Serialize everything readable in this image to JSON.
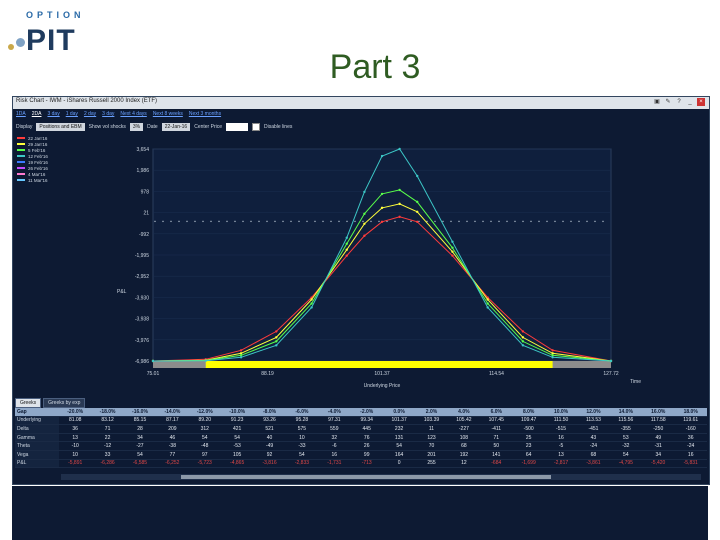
{
  "logo": {
    "top": "OPTION",
    "main": "PIT"
  },
  "slide_title": "Part 3",
  "window": {
    "title": "Risk Chart - IWM - iShares Russell 2000 Index (ETF)"
  },
  "ranges": [
    "1DA",
    "2DA",
    "3 day",
    "1 day",
    "2 day",
    "3 day",
    "Next 4 days",
    "Next 8 weeks",
    "Next 3 months"
  ],
  "toolbar": {
    "display_label": "Display",
    "display_value": "Positions and EBM",
    "vol_label": "Show vol shocks",
    "vol_value": "3%",
    "date_label": "Date",
    "date_value": "22-Jan-16",
    "center_label": "Center Price",
    "disable_label": "Disable lines"
  },
  "legend": [
    {
      "label": "22 Jan'16",
      "color": "#ff3b3b"
    },
    {
      "label": "29 Jan'16",
      "color": "#ffff3b"
    },
    {
      "label": "5 Feb'16",
      "color": "#59ff4a"
    },
    {
      "label": "12 Feb'16",
      "color": "#3cc7c7"
    },
    {
      "label": "19 Feb'16",
      "color": "#3b7bff"
    },
    {
      "label": "26 Feb'16",
      "color": "#c44bff"
    },
    {
      "label": "4 Mar'16",
      "color": "#ff7ad1"
    },
    {
      "label": "11 Mar'16",
      "color": "#66c8ff"
    }
  ],
  "axes": {
    "ylabel": "P&L",
    "xlabel": "Underlying Price",
    "yticks": [
      "3,654",
      "1,986",
      "978",
      "21",
      "-992",
      "-1,995",
      "-2,952",
      "-3,930",
      "-3,938",
      "-3,976",
      "-6,986"
    ],
    "xticks": [
      "75.01",
      "88.19",
      "101.37",
      "114.54",
      "127.72"
    ],
    "time_label": "Time"
  },
  "tabs": [
    "Greeks",
    "Greeks by exp"
  ],
  "table": {
    "headers": [
      "Gap",
      "-20.0%",
      "-18.0%",
      "-16.0%",
      "-14.0%",
      "-12.0%",
      "-10.0%",
      "-8.0%",
      "-6.0%",
      "-4.0%",
      "-2.0%",
      "0.0%",
      "2.0%",
      "4.0%",
      "6.0%",
      "8.0%",
      "10.0%",
      "12.0%",
      "14.0%",
      "16.0%",
      "18.0%"
    ],
    "rows": [
      {
        "label": "Underlying",
        "cells": [
          "81.08",
          "83.12",
          "85.15",
          "87.17",
          "89.20",
          "91.23",
          "93.26",
          "95.28",
          "97.31",
          "99.34",
          "101.37",
          "103.39",
          "105.42",
          "107.45",
          "109.47",
          "111.50",
          "113.53",
          "115.56",
          "117.58",
          "119.61"
        ]
      },
      {
        "label": "Delta",
        "cells": [
          "36",
          "71",
          "28",
          "209",
          "312",
          "421",
          "521",
          "575",
          "559",
          "445",
          "232",
          "11",
          "-227",
          "-411",
          "-500",
          "-515",
          "-451",
          "-355",
          "-250",
          "-160"
        ]
      },
      {
        "label": "Gamma",
        "cells": [
          "13",
          "22",
          "34",
          "46",
          "54",
          "54",
          "40",
          "10",
          "32",
          "76",
          "131",
          "123",
          "108",
          "71",
          "25",
          "16",
          "43",
          "53",
          "49",
          "36"
        ]
      },
      {
        "label": "Theta",
        "cells": [
          "-10",
          "-12",
          "-27",
          "-38",
          "-48",
          "-53",
          "-49",
          "-33",
          "-6",
          "26",
          "54",
          "70",
          "68",
          "50",
          "23",
          "-5",
          "-24",
          "-32",
          "-31",
          "-24"
        ]
      },
      {
        "label": "Vega",
        "cells": [
          "10",
          "33",
          "54",
          "77",
          "97",
          "105",
          "92",
          "54",
          "16",
          "99",
          "164",
          "201",
          "192",
          "141",
          "64",
          "13",
          "68",
          "54",
          "34",
          "16"
        ]
      },
      {
        "label": "P&L",
        "cells": [
          "-5,891",
          "-6,286",
          "-6,585",
          "-6,252",
          "-5,723",
          "-4,865",
          "-3,816",
          "-2,833",
          "-1,731",
          "-713",
          "0",
          "255",
          "12",
          "-684",
          "-1,699",
          "-2,817",
          "-3,861",
          "-4,795",
          "-5,420",
          "-5,831"
        ]
      }
    ]
  },
  "chart_data": {
    "type": "line",
    "title": "",
    "xlabel": "Underlying Price",
    "ylabel": "P&L",
    "xlim": [
      75.01,
      127.72
    ],
    "ylim": [
      -6986,
      3654
    ],
    "x": [
      75.01,
      81.08,
      85.15,
      89.2,
      93.26,
      97.31,
      99.34,
      101.37,
      103.39,
      105.42,
      109.47,
      113.53,
      117.58,
      121.0,
      127.72
    ],
    "series": [
      {
        "name": "22 Jan'16",
        "color": "#ff3b3b",
        "values": [
          -6986,
          -6900,
          -6450,
          -5500,
          -3800,
          -1700,
          -700,
          0,
          250,
          0,
          -1700,
          -3800,
          -5500,
          -6450,
          -6986
        ]
      },
      {
        "name": "29 Jan'16",
        "color": "#ffff3b",
        "values": [
          -6986,
          -6950,
          -6600,
          -5800,
          -3900,
          -1400,
          -100,
          700,
          900,
          500,
          -1500,
          -3900,
          -5800,
          -6600,
          -6986
        ]
      },
      {
        "name": "5 Feb'16",
        "color": "#59ff4a",
        "values": [
          -6986,
          -6960,
          -6700,
          -6000,
          -4100,
          -1100,
          400,
          1400,
          1600,
          1000,
          -1300,
          -4100,
          -6000,
          -6700,
          -6986
        ]
      },
      {
        "name": "12 Feb'16",
        "color": "#3cc7c7",
        "values": [
          -6986,
          -6970,
          -6800,
          -6200,
          -4300,
          -800,
          1500,
          3300,
          3654,
          2300,
          -1000,
          -4300,
          -6200,
          -6800,
          -6986
        ]
      }
    ],
    "range_bar": {
      "from": 81.08,
      "to": 121.0,
      "color": "#ffff00"
    }
  }
}
